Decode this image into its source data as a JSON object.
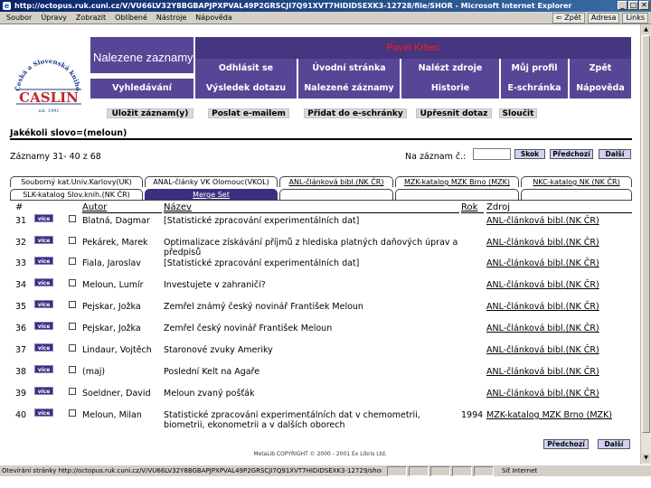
{
  "window": {
    "title": "http://octopus.ruk.cuni.cz/V/VU66LV32Y8BGBAPJPXPVAL49P2GRSCJI7Q91XVT7HIDIDSEXK3-12728/file/SHOR - Microsoft Internet Explorer",
    "menu": [
      "Soubor",
      "Úpravy",
      "Zobrazit",
      "Oblíbené",
      "Nástroje",
      "Nápověda"
    ],
    "back_label": "⇐ Zpět",
    "address_label": "Adresa",
    "links_label": "Links",
    "minimize": "_",
    "maximize": "□",
    "close": "✕"
  },
  "logo": {
    "text": "CASLIN",
    "ring_text": "Česká a Slovenská knihovní informační síť",
    "year": "zal. 1991"
  },
  "header": {
    "page_title": "Nalezene zaznamy",
    "user_name": "Pavel Krbec"
  },
  "nav": {
    "row1": [
      "Odhlásit se",
      "Úvodní stránka",
      "Nalézt zdroje",
      "Můj profil",
      "Zpět"
    ],
    "row2": [
      "Vyhledávání",
      "Výsledek dotazu",
      "Nalezené záznamy",
      "Historie",
      "E-schránka",
      "Nápověda"
    ]
  },
  "actions": [
    "Uložit záznam(y)",
    "Poslat e-mailem",
    "Přidat do e-schránky",
    "Upřesnit dotaz",
    "Sloučit"
  ],
  "query": "Jakékoli slovo=(meloun)",
  "records_range": "Záznamy 31- 40 z 68",
  "jump": {
    "label": "Na záznam č.:",
    "value": "",
    "skok": "Skok",
    "prev": "Předchozí",
    "next": "Další"
  },
  "tabs": {
    "row1": [
      "Souborný kat.Univ.Karlovy(UK)",
      "ANAL-články VK Olomouc(VKOL)",
      "ANL-článková bibl.(NK ČR)",
      "MZK-katalog MZK Brno (MZK)",
      "NKC-katalog NK (NK ČR)"
    ],
    "row2": [
      "SLK-katalog Slov.knih.(NK ČR)",
      "Merge Set"
    ]
  },
  "table": {
    "headers": {
      "num": "#",
      "author": "Autor",
      "title": "Název",
      "year": "Rok",
      "source": "Zdroj"
    },
    "vice_label": "více",
    "rows": [
      {
        "num": "31",
        "author": "Blatná, Dagmar",
        "title": "[Statistické zpracování experimentálních dat]",
        "year": "",
        "source": "ANL-článková bibl.(NK ČR)"
      },
      {
        "num": "32",
        "author": "Pekárek, Marek",
        "title": "Optimalizace získávání příjmů z hlediska platných daňových úprav a předpisů",
        "year": "",
        "source": "ANL-článková bibl.(NK ČR)"
      },
      {
        "num": "33",
        "author": "Fiala, Jaroslav",
        "title": "[Statistické zpracování experimentálních dat]",
        "year": "",
        "source": "ANL-článková bibl.(NK ČR)"
      },
      {
        "num": "34",
        "author": "Meloun, Lumír",
        "title": "Investujete v zahraničí?",
        "year": "",
        "source": "ANL-článková bibl.(NK ČR)"
      },
      {
        "num": "35",
        "author": "Pejskar, Jožka",
        "title": "Zemřel známý český novinář František Meloun",
        "year": "",
        "source": "ANL-článková bibl.(NK ČR)"
      },
      {
        "num": "36",
        "author": "Pejskar, Jožka",
        "title": "Zemřel český novinář František Meloun",
        "year": "",
        "source": "ANL-článková bibl.(NK ČR)"
      },
      {
        "num": "37",
        "author": "Lindaur, Vojtěch",
        "title": "Staronové zvuky Ameriky",
        "year": "",
        "source": "ANL-článková bibl.(NK ČR)"
      },
      {
        "num": "38",
        "author": "(maj)",
        "title": "Poslední Kelt na Agaře",
        "year": "",
        "source": "ANL-článková bibl.(NK ČR)"
      },
      {
        "num": "39",
        "author": "Soeldner, David",
        "title": "Meloun zvaný pošťák",
        "year": "",
        "source": "ANL-článková bibl.(NK ČR)"
      },
      {
        "num": "40",
        "author": "Meloun, Milan",
        "title": "Statistické zpracování experimentálních dat v chemometrii, biometrii, ekonometrii a v dalších oborech",
        "year": "1994",
        "source": "MZK-katalog MZK Brno (MZK)"
      }
    ]
  },
  "footer": {
    "text": "MetaLib COPYRIGHT © 2000 - 2001 Ex Libris Ltd.",
    "prev": "Předchozí",
    "next": "Další"
  },
  "status": {
    "text": "Otevírání stránky http://octopus.ruk.cuni.cz/V/VU66LV32Y8BGBAPJPXPVAL49P2GRSCJI7Q91XVT7HIDIDSEXK3-12729/short...",
    "zone": "Síť Internet"
  },
  "colors": {
    "nav_purple": "#574696",
    "dark_purple": "#45367f",
    "user_red": "#ff1a1a"
  }
}
